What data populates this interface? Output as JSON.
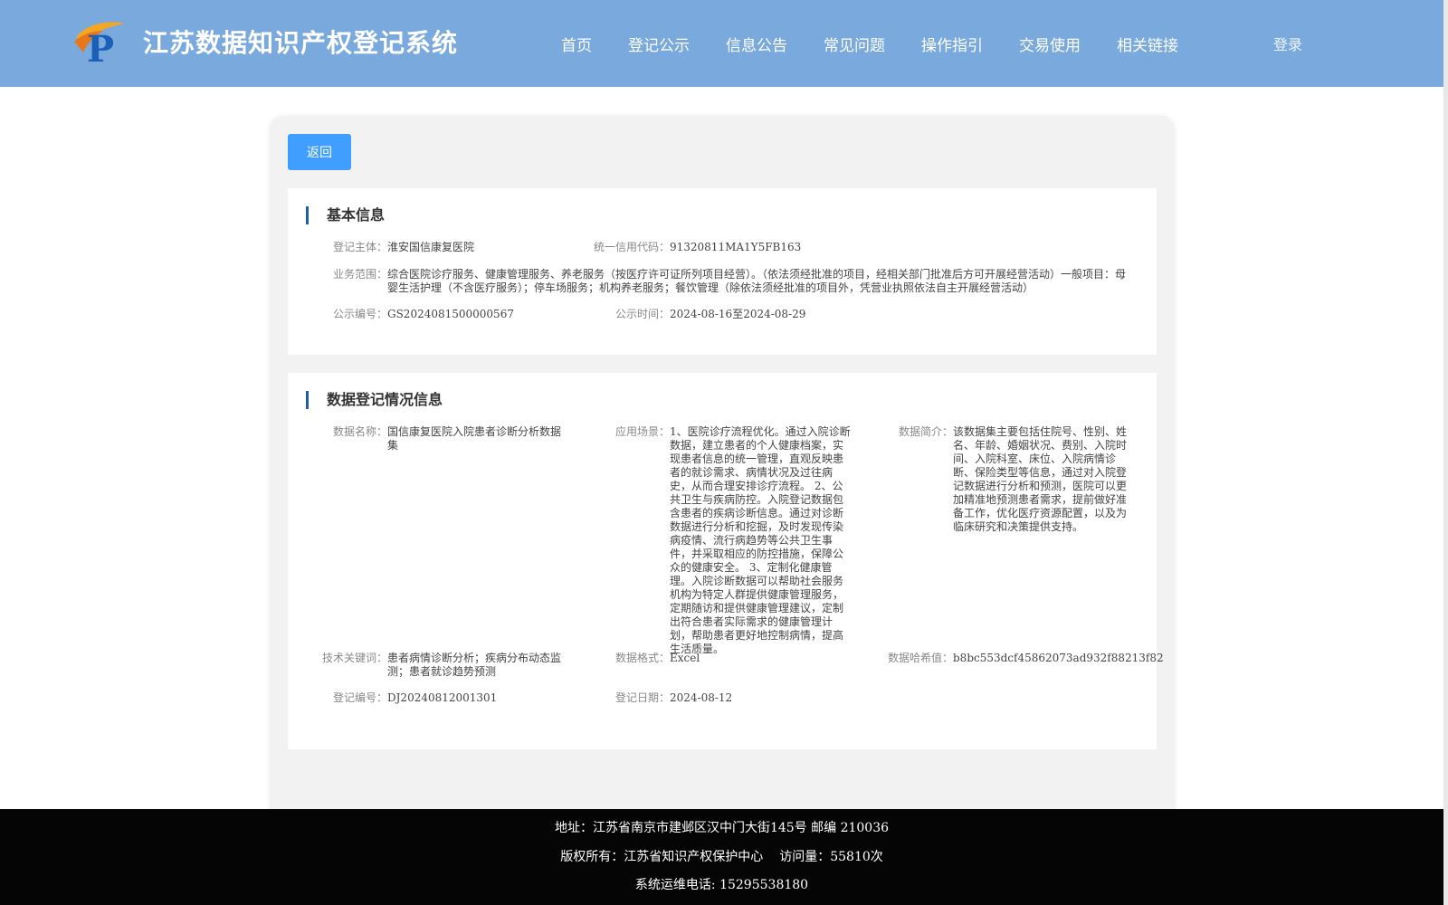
{
  "header": {
    "title": "江苏数据知识产权登记系统",
    "nav": [
      "首页",
      "登记公示",
      "信息公告",
      "常见问题",
      "操作指引",
      "交易使用",
      "相关链接"
    ],
    "login": "登录"
  },
  "back_label": "返回",
  "basic": {
    "title": "基本信息",
    "subject_label": "登记主体：",
    "subject": "淮安国信康复医院",
    "credit_label": "统一信用代码：",
    "credit": "91320811MA1Y5FB163",
    "scope_label": "业务范围：",
    "scope": "综合医院诊疗服务、健康管理服务、养老服务（按医疗许可证所列项目经营）。（依法须经批准的项目，经相关部门批准后方可开展经营活动）一般项目：母婴生活护理（不含医疗服务）；停车场服务；机构养老服务；餐饮管理（除依法须经批准的项目外，凭营业执照依法自主开展经营活动）",
    "pub_no_label": "公示编号：",
    "pub_no": "GS2024081500000567",
    "pub_time_label": "公示时间：",
    "pub_time": "2024-08-16至2024-08-29"
  },
  "reg": {
    "title": "数据登记情况信息",
    "name_label": "数据名称：",
    "name": "国信康复医院入院患者诊断分析数据集",
    "scene_label": "应用场景：",
    "scene": "1、医院诊疗流程优化。通过入院诊断数据，建立患者的个人健康档案，实现患者信息的统一管理，直观反映患者的就诊需求、病情状况及过往病史，从而合理安排诊疗流程。 2、公共卫生与疾病防控。入院登记数据包含患者的疾病诊断信息。通过对诊断数据进行分析和挖掘，及时发现传染病疫情、流行病趋势等公共卫生事件，并采取相应的防控措施，保障公众的健康安全。 3、定制化健康管理。入院诊断数据可以帮助社会服务机构为特定人群提供健康管理服务，定期随访和提供健康管理建议，定制出符合患者实际需求的健康管理计划，帮助患者更好地控制病情，提高生活质量。",
    "intro_label": "数据简介：",
    "intro": "该数据集主要包括住院号、性别、姓名、年龄、婚姻状况、费别、入院时间、入院科室、床位、入院病情诊断、保险类型等信息，通过对入院登记数据进行分析和预测，医院可以更加精准地预测患者需求，提前做好准备工作，优化医疗资源配置，以及为临床研究和决策提供支持。",
    "keywords_label": "技术关键词：",
    "keywords": "患者病情诊断分析；疾病分布动态监测；患者就诊趋势预测",
    "format_label": "数据格式：",
    "format": "Excel",
    "hash_label": "数据哈希值：",
    "hash": "b8bc553dcf45862073ad932f88213f82",
    "reg_no_label": "登记编号：",
    "reg_no": "DJ20240812001301",
    "reg_date_label": "登记日期：",
    "reg_date": "2024-08-12"
  },
  "footer": {
    "address": "地址：江苏省南京市建邺区汉中门大街145号 邮编 210036",
    "copyright": "版权所有：江苏省知识产权保护中心",
    "visits": "访问量：55810次",
    "phone": "系统运维电话: 15295538180"
  }
}
